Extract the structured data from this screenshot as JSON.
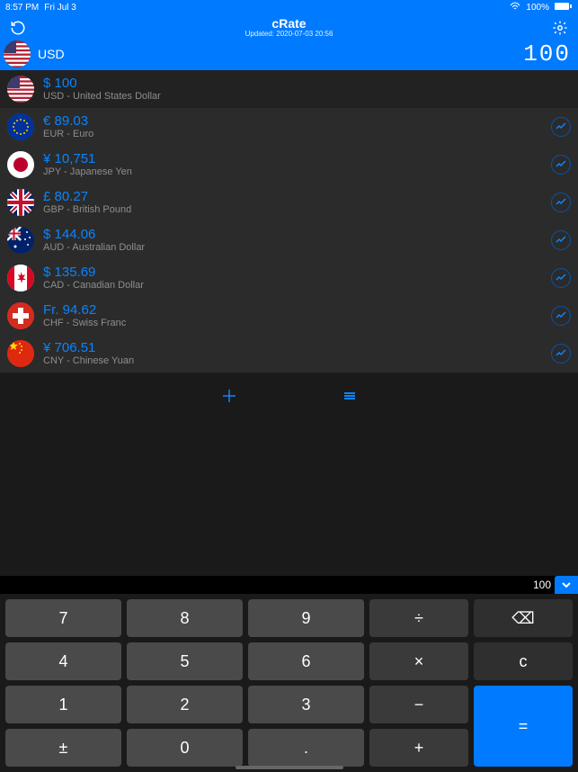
{
  "status": {
    "time": "8:57 PM",
    "date": "Fri Jul 3",
    "signal_pct": "100%"
  },
  "header": {
    "title": "cRate",
    "updated": "Updated: 2020-07-03 20:56"
  },
  "base": {
    "code": "USD",
    "display_amount": "100"
  },
  "currencies": [
    {
      "amount": "$ 100",
      "sub": "USD - United States Dollar",
      "flag": "us",
      "chart": false
    },
    {
      "amount": "€ 89.03",
      "sub": "EUR - Euro",
      "flag": "eu",
      "chart": true
    },
    {
      "amount": "¥ 10,751",
      "sub": "JPY - Japanese Yen",
      "flag": "jp",
      "chart": true
    },
    {
      "amount": "£ 80.27",
      "sub": "GBP - British Pound",
      "flag": "gb",
      "chart": true
    },
    {
      "amount": "$ 144.06",
      "sub": "AUD - Australian Dollar",
      "flag": "au",
      "chart": true
    },
    {
      "amount": "$ 135.69",
      "sub": "CAD - Canadian Dollar",
      "flag": "ca",
      "chart": true
    },
    {
      "amount": "Fr. 94.62",
      "sub": "CHF - Swiss Franc",
      "flag": "ch",
      "chart": true
    },
    {
      "amount": "¥ 706.51",
      "sub": "CNY - Chinese Yuan",
      "flag": "cn",
      "chart": true
    }
  ],
  "input": {
    "value": "100"
  },
  "keypad": {
    "k7": "7",
    "k8": "8",
    "k9": "9",
    "div": "÷",
    "bsp": "⌫",
    "k4": "4",
    "k5": "5",
    "k6": "6",
    "mul": "×",
    "clr": "c",
    "k1": "1",
    "k2": "2",
    "k3": "3",
    "sub": "−",
    "eq": "=",
    "pm": "±",
    "k0": "0",
    "dot": ".",
    "add": "+"
  }
}
